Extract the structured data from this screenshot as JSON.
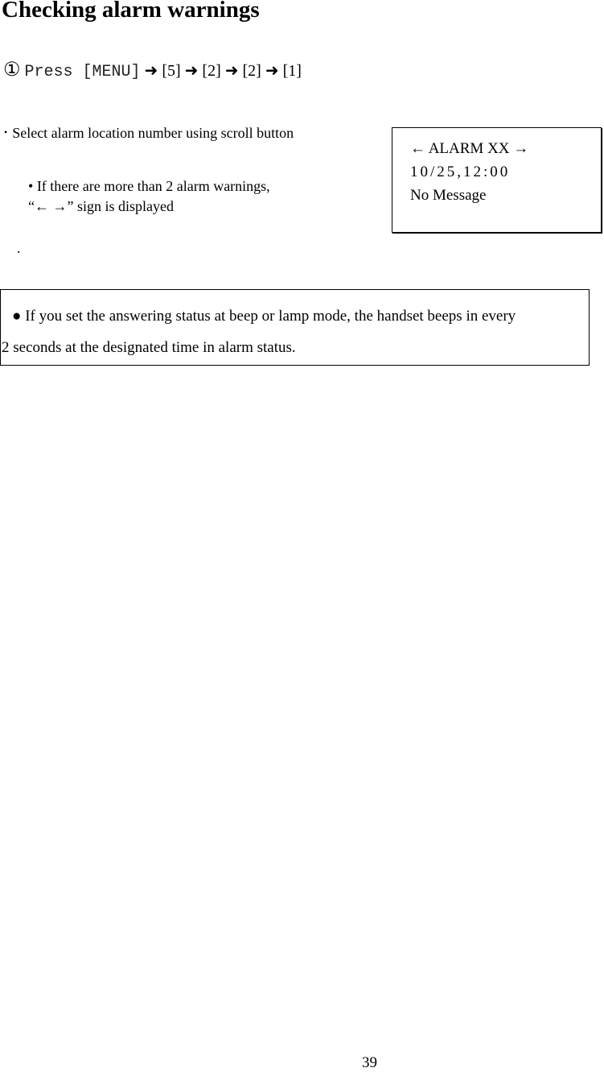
{
  "title": "Checking alarm warnings",
  "step": {
    "number_glyph": "①",
    "press_label": "Press [MENU]",
    "arrow_glyph": "➜",
    "keys": [
      "[5]",
      "[2]",
      "[2]",
      "[1]"
    ]
  },
  "bullets": {
    "select_text": "Select alarm location number using scroll button",
    "small_bullet_glyph": "•",
    "warning_bullet_glyph": "•",
    "warning_text_line1": "If there are more than 2 alarm warnings,",
    "warning_text_line2": "“← →” sign is displayed",
    "stray_mark": "."
  },
  "lcd_display": {
    "left_arrow": "←",
    "label": "ALARM XX",
    "right_arrow": "→",
    "datetime": "10/25,12:00",
    "message": "No Message"
  },
  "note": {
    "bullet_glyph": "●",
    "line1": "If you set the answering status at beep or lamp mode, the handset beeps in every",
    "line2": "2 seconds at the designated time in alarm status."
  },
  "page_number": "39"
}
